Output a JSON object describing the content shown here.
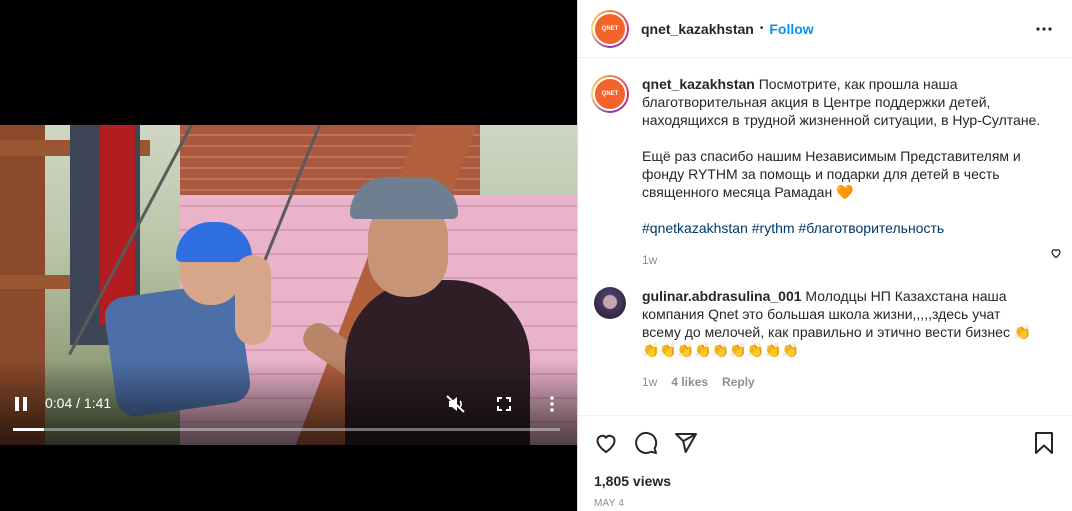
{
  "video": {
    "current_time": "0:04",
    "duration": "1:41",
    "time_separator": " / ",
    "progress_fraction": 0.057,
    "muted": true
  },
  "post": {
    "username": "qnet_kazakhstan",
    "avatar_text": "QNET",
    "separator": "•",
    "follow_label": "Follow",
    "more_icon": "more-horizontal-icon",
    "caption_p1": "Посмотрите, как прошла наша благотворительная акция в Центре поддержки детей, находящихся в трудной жизненной ситуации, в Нур-Султане.",
    "caption_p2": "Ещё раз спасибо нашим Независимым Представителям и фонду RYTHM за помощь и подарки для детей в честь священного месяца Рамадан 🧡",
    "hashtags": "#qnetkazakhstan #rythm #благотворительность",
    "caption_age": "1w"
  },
  "comment": {
    "username": "gulinar.abdrasulina_001",
    "text": "Молодцы НП Казахстана наша компания Qnet это большая школа жизни,,,,,здесь учат всему до мелочей, как правильно и этично вести бизнес 👏👏👏👏👏👏👏👏👏👏",
    "age": "1w",
    "likes": "4 likes",
    "reply_label": "Reply"
  },
  "footer": {
    "views": "1,805 views",
    "date": "MAY 4"
  },
  "colors": {
    "follow_blue": "#0095f6",
    "hashtag": "#00376b",
    "muted_text": "#8e8e8e",
    "brand_orange": "#f4632a"
  }
}
